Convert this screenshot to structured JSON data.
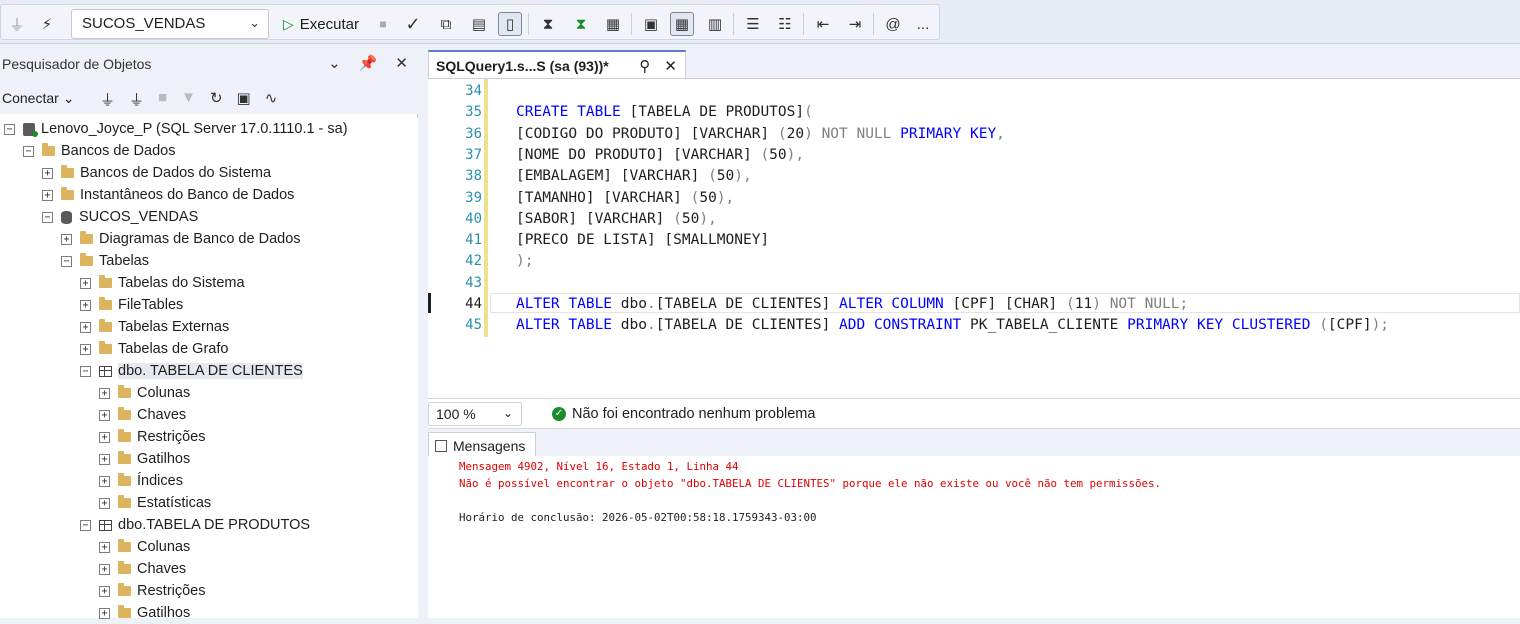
{
  "toolbar": {
    "database_selected": "SUCOS_VENDAS",
    "execute_label": "Executar",
    "more_label": "..."
  },
  "explorer": {
    "title": "Pesquisador de Objetos",
    "connect_label": "Conectar",
    "tree": [
      {
        "label": "Lenovo_Joyce_P (SQL Server 17.0.1110.1 - sa)",
        "indent": 0,
        "exp": "−",
        "icon": "server"
      },
      {
        "label": "Bancos de Dados",
        "indent": 1,
        "exp": "−",
        "icon": "folder"
      },
      {
        "label": "Bancos de Dados do Sistema",
        "indent": 2,
        "exp": "+",
        "icon": "folder"
      },
      {
        "label": "Instantâneos do Banco de Dados",
        "indent": 2,
        "exp": "+",
        "icon": "folder"
      },
      {
        "label": "SUCOS_VENDAS",
        "indent": 2,
        "exp": "−",
        "icon": "database"
      },
      {
        "label": "Diagramas de Banco de Dados",
        "indent": 3,
        "exp": "+",
        "icon": "folder"
      },
      {
        "label": "Tabelas",
        "indent": 3,
        "exp": "−",
        "icon": "folder"
      },
      {
        "label": "Tabelas do Sistema",
        "indent": 4,
        "exp": "+",
        "icon": "folder"
      },
      {
        "label": "FileTables",
        "indent": 4,
        "exp": "+",
        "icon": "folder"
      },
      {
        "label": "Tabelas Externas",
        "indent": 4,
        "exp": "+",
        "icon": "folder"
      },
      {
        "label": "Tabelas de Grafo",
        "indent": 4,
        "exp": "+",
        "icon": "folder"
      },
      {
        "label": "dbo. TABELA DE CLIENTES",
        "indent": 4,
        "exp": "−",
        "icon": "table",
        "selected": true
      },
      {
        "label": "Colunas",
        "indent": 5,
        "exp": "+",
        "icon": "folder"
      },
      {
        "label": "Chaves",
        "indent": 5,
        "exp": "+",
        "icon": "folder"
      },
      {
        "label": "Restrições",
        "indent": 5,
        "exp": "+",
        "icon": "folder"
      },
      {
        "label": "Gatilhos",
        "indent": 5,
        "exp": "+",
        "icon": "folder"
      },
      {
        "label": "Índices",
        "indent": 5,
        "exp": "+",
        "icon": "folder"
      },
      {
        "label": "Estatísticas",
        "indent": 5,
        "exp": "+",
        "icon": "folder"
      },
      {
        "label": "dbo.TABELA DE PRODUTOS",
        "indent": 4,
        "exp": "−",
        "icon": "table"
      },
      {
        "label": "Colunas",
        "indent": 5,
        "exp": "+",
        "icon": "folder"
      },
      {
        "label": "Chaves",
        "indent": 5,
        "exp": "+",
        "icon": "folder"
      },
      {
        "label": "Restrições",
        "indent": 5,
        "exp": "+",
        "icon": "folder"
      },
      {
        "label": "Gatilhos",
        "indent": 5,
        "exp": "+",
        "icon": "folder"
      }
    ]
  },
  "editor": {
    "tab_title": "SQLQuery1.s...S (sa (93))*",
    "current_line": 44,
    "lines": [
      {
        "n": 34,
        "tokens": []
      },
      {
        "n": 35,
        "tokens": [
          [
            "kw",
            "CREATE TABLE "
          ],
          [
            "tx",
            "[TABELA DE PRODUTOS]"
          ],
          [
            "gr",
            "("
          ]
        ]
      },
      {
        "n": 36,
        "tokens": [
          [
            "tx",
            "[CODIGO DO PRODUTO] [VARCHAR] "
          ],
          [
            "gr",
            "("
          ],
          [
            "tx",
            "20"
          ],
          [
            "gr",
            ") NOT NULL "
          ],
          [
            "kw",
            "PRIMARY KEY"
          ],
          [
            "gr",
            ","
          ]
        ]
      },
      {
        "n": 37,
        "tokens": [
          [
            "tx",
            "[NOME DO PRODUTO] [VARCHAR] "
          ],
          [
            "gr",
            "("
          ],
          [
            "tx",
            "50"
          ],
          [
            "gr",
            "),"
          ]
        ]
      },
      {
        "n": 38,
        "tokens": [
          [
            "tx",
            "[EMBALAGEM] [VARCHAR] "
          ],
          [
            "gr",
            "("
          ],
          [
            "tx",
            "50"
          ],
          [
            "gr",
            "),"
          ]
        ]
      },
      {
        "n": 39,
        "tokens": [
          [
            "tx",
            "[TAMANHO] [VARCHAR] "
          ],
          [
            "gr",
            "("
          ],
          [
            "tx",
            "50"
          ],
          [
            "gr",
            "),"
          ]
        ]
      },
      {
        "n": 40,
        "tokens": [
          [
            "tx",
            "[SABOR] [VARCHAR] "
          ],
          [
            "gr",
            "("
          ],
          [
            "tx",
            "50"
          ],
          [
            "gr",
            "),"
          ]
        ]
      },
      {
        "n": 41,
        "tokens": [
          [
            "tx",
            "[PRECO DE LISTA] [SMALLMONEY]"
          ]
        ]
      },
      {
        "n": 42,
        "tokens": [
          [
            "gr",
            ");"
          ]
        ]
      },
      {
        "n": 43,
        "tokens": []
      },
      {
        "n": 44,
        "tokens": [
          [
            "kw",
            "ALTER TABLE "
          ],
          [
            "tx",
            "dbo"
          ],
          [
            "gr",
            "."
          ],
          [
            "tx",
            "[TABELA DE CLIENTES] "
          ],
          [
            "kw",
            "ALTER COLUMN "
          ],
          [
            "tx",
            "[CPF] [CHAR] "
          ],
          [
            "gr",
            "("
          ],
          [
            "tx",
            "11"
          ],
          [
            "gr",
            ") NOT NULL;"
          ]
        ]
      },
      {
        "n": 45,
        "tokens": [
          [
            "kw",
            "ALTER TABLE "
          ],
          [
            "tx",
            "dbo"
          ],
          [
            "gr",
            "."
          ],
          [
            "tx",
            "[TABELA DE CLIENTES] "
          ],
          [
            "kw",
            "ADD CONSTRAINT "
          ],
          [
            "tx",
            "PK_TABELA_CLIENTE "
          ],
          [
            "kw",
            "PRIMARY KEY CLUSTERED "
          ],
          [
            "gr",
            "("
          ],
          [
            "tx",
            "[CPF]"
          ],
          [
            "gr",
            ");"
          ]
        ]
      }
    ]
  },
  "status": {
    "zoom": "100 %",
    "message": "Não foi encontrado nenhum problema"
  },
  "messages": {
    "tab_label": "Mensagens",
    "lines": [
      {
        "text": "Mensagem 4902, Nível 16, Estado 1, Linha 44",
        "type": "err"
      },
      {
        "text": "Não é possível encontrar o objeto \"dbo.TABELA DE CLIENTES\" porque ele não existe ou você não tem permissões.",
        "type": "err"
      },
      {
        "text": "",
        "type": "info"
      },
      {
        "text": "Horário de conclusão: 2026-05-02T00:58:18.1759343-03:00",
        "type": "info"
      }
    ]
  },
  "colors": {
    "keyword": "#0000ff",
    "punctuation": "#808080",
    "error": "#e00000",
    "line_number": "#2b91af",
    "accent": "#5b7bd5"
  }
}
